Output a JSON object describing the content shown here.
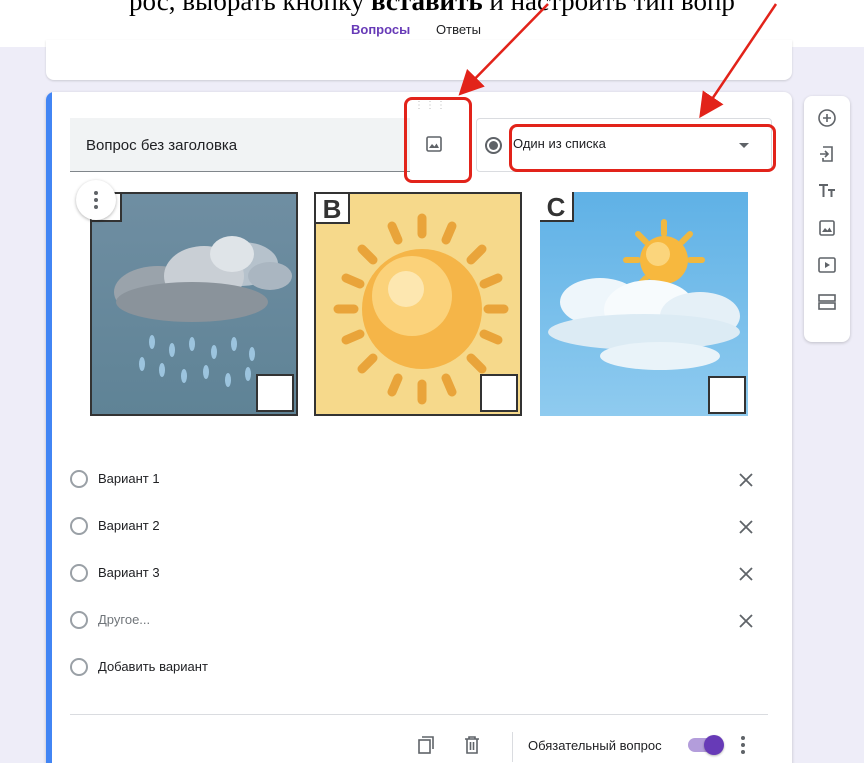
{
  "caption": {
    "part1": "рос, выбрать кнопку ",
    "bold": "вставить",
    "part2": " и настроить тип вопр"
  },
  "tabs": [
    {
      "label": "Вопросы",
      "active": true
    },
    {
      "label": "Ответы",
      "active": false
    }
  ],
  "question": {
    "title": "Вопрос без заголовка",
    "type": "Один из списка",
    "images": [
      {
        "letter": "",
        "icon": "rain-cloud-image"
      },
      {
        "letter": "B",
        "icon": "sun-image"
      },
      {
        "letter": "C",
        "icon": "sun-behind-cloud-image"
      }
    ],
    "options": [
      {
        "label": "Вариант 1"
      },
      {
        "label": "Вариант 2"
      },
      {
        "label": "Вариант 3"
      },
      {
        "label": "Другое..."
      },
      {
        "label": "Добавить вариант"
      }
    ],
    "required_label": "Обязательный вопрос",
    "required": true
  },
  "toolbar": {
    "icons": [
      "add-question-icon",
      "import-questions-icon",
      "add-title-icon",
      "add-image-icon",
      "add-video-icon",
      "add-section-icon"
    ]
  },
  "colors": {
    "accent": "#673ab7",
    "card_accent": "#4285f4",
    "highlight": "#e2231a",
    "background": "#eeedf8"
  }
}
